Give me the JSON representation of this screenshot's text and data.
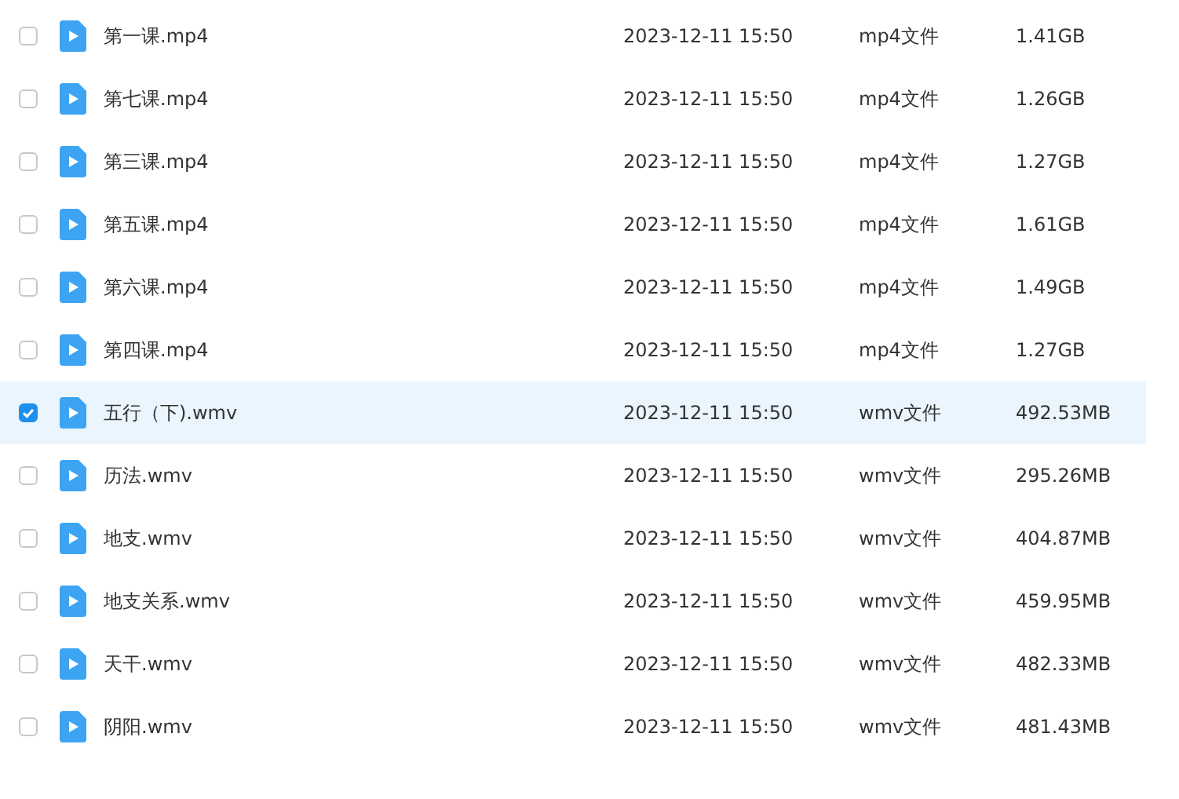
{
  "files": [
    {
      "name": "第一课.mp4",
      "date": "2023-12-11 15:50",
      "type": "mp4文件",
      "size": "1.41GB",
      "selected": false
    },
    {
      "name": "第七课.mp4",
      "date": "2023-12-11 15:50",
      "type": "mp4文件",
      "size": "1.26GB",
      "selected": false
    },
    {
      "name": "第三课.mp4",
      "date": "2023-12-11 15:50",
      "type": "mp4文件",
      "size": "1.27GB",
      "selected": false
    },
    {
      "name": "第五课.mp4",
      "date": "2023-12-11 15:50",
      "type": "mp4文件",
      "size": "1.61GB",
      "selected": false
    },
    {
      "name": "第六课.mp4",
      "date": "2023-12-11 15:50",
      "type": "mp4文件",
      "size": "1.49GB",
      "selected": false
    },
    {
      "name": "第四课.mp4",
      "date": "2023-12-11 15:50",
      "type": "mp4文件",
      "size": "1.27GB",
      "selected": false
    },
    {
      "name": "五行（下).wmv",
      "date": "2023-12-11 15:50",
      "type": "wmv文件",
      "size": "492.53MB",
      "selected": true
    },
    {
      "name": "历法.wmv",
      "date": "2023-12-11 15:50",
      "type": "wmv文件",
      "size": "295.26MB",
      "selected": false
    },
    {
      "name": "地支.wmv",
      "date": "2023-12-11 15:50",
      "type": "wmv文件",
      "size": "404.87MB",
      "selected": false
    },
    {
      "name": "地支关系.wmv",
      "date": "2023-12-11 15:50",
      "type": "wmv文件",
      "size": "459.95MB",
      "selected": false
    },
    {
      "name": "天干.wmv",
      "date": "2023-12-11 15:50",
      "type": "wmv文件",
      "size": "482.33MB",
      "selected": false
    },
    {
      "name": "阴阳.wmv",
      "date": "2023-12-11 15:50",
      "type": "wmv文件",
      "size": "481.43MB",
      "selected": false
    }
  ]
}
